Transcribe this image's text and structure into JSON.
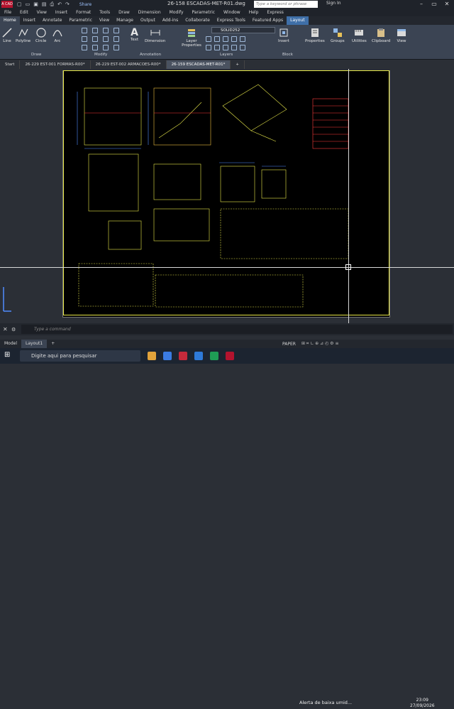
{
  "titlebar": {
    "app_badge": "A CAD",
    "share": "Share",
    "document_title": "26-158 ESCADAS-MET-R01.dwg",
    "search_placeholder": "Type a keyword or phrase",
    "sign_in": "Sign In"
  },
  "menu": [
    "File",
    "Edit",
    "View",
    "Insert",
    "Format",
    "Tools",
    "Draw",
    "Dimension",
    "Modify",
    "Parametric",
    "Window",
    "Help",
    "Express"
  ],
  "ribbon_tabs": [
    "Home",
    "Insert",
    "Annotate",
    "Parametric",
    "View",
    "Manage",
    "Output",
    "Add-ins",
    "Collaborate",
    "Express Tools",
    "Featured Apps",
    "Layout"
  ],
  "ribbon": {
    "draw": {
      "line": "Line",
      "polyline": "Polyline",
      "circle": "Circle",
      "arc": "Arc",
      "label": "Draw"
    },
    "modify": {
      "label": "Modify"
    },
    "annotation": {
      "text": "Text",
      "dimension": "Dimension",
      "label": "Annotation"
    },
    "layers": {
      "layer_properties": "Layer Properties",
      "current_layer": "SOLID252",
      "label": "Layers"
    },
    "block": {
      "insert": "Insert",
      "label": "Block"
    },
    "properties": "Properties",
    "groups": "Groups",
    "utilities": "Utilities",
    "clipboard": "Clipboard",
    "view": "View"
  },
  "file_tabs": [
    "Start",
    "26-229 EST-001 FORMAS-R00*",
    "26-229 EST-002 ARMACOES-R00*",
    "26-159 ESCADAS-MET-R01*"
  ],
  "command": {
    "placeholder": "Type a command"
  },
  "status": {
    "model": "Model",
    "layout": "Layout1",
    "paper": "PAPER"
  },
  "taskbar": {
    "search_placeholder": "Digite aqui para pesquisar",
    "alert": "Alerta de baixa umid...",
    "time": "23:09",
    "date": "27/09/2026"
  },
  "colors": {
    "accent": "#3f6fa8",
    "paper": "#000000",
    "viewport": "#e8e84a",
    "drawing_bg": "#2b2f36"
  }
}
